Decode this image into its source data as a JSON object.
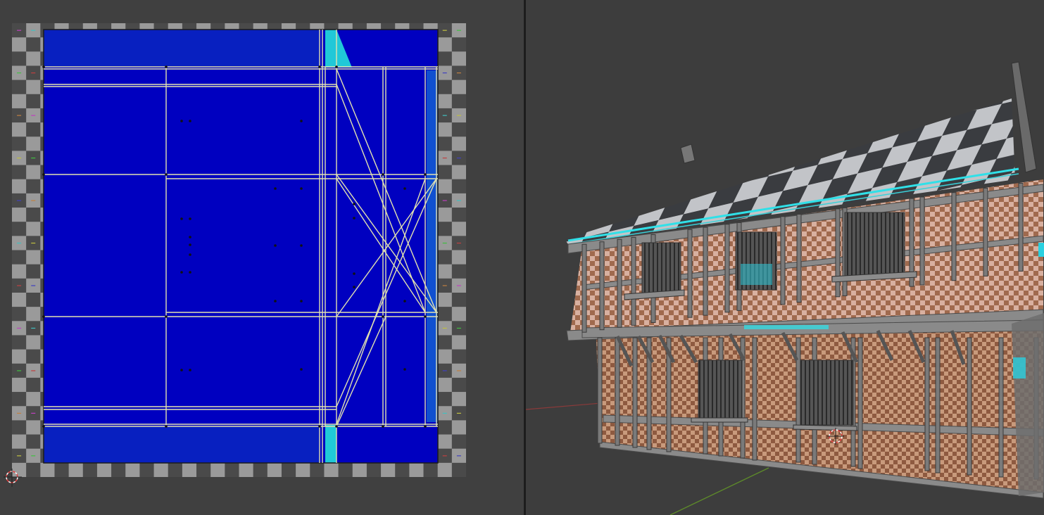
{
  "colors": {
    "uv_fill": "#0000c4",
    "uv_fill_light": "#0a2fd0",
    "uv_edge": "#e6e6b8",
    "seam": "#20d4e0",
    "checker_dark": "#4a4a4a",
    "checker_light": "#9a9a9a",
    "editor_bg": "#404040",
    "viewport_bg": "#3d3d3d",
    "axis_x": "#a33a3a",
    "axis_y": "#5f8a2a"
  },
  "uv_editor": {
    "texture": "uv-checker-grid",
    "cursor_icon": "2d-cursor-icon"
  },
  "viewport": {
    "object": "half-timbered-house",
    "cursor_icon": "3d-cursor-icon"
  }
}
